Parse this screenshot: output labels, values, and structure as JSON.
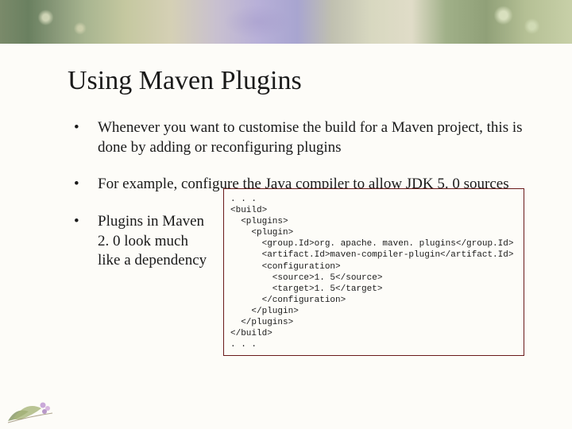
{
  "title": "Using Maven Plugins",
  "bullets": [
    "Whenever you want to customise the build for a Maven project, this is done by adding or reconfiguring plugins",
    "For example, configure the Java compiler to allow JDK 5. 0 sources",
    "Plugins in Maven 2. 0 look much like a dependency"
  ],
  "code": ". . .\n<build>\n  <plugins>\n    <plugin>\n      <group.Id>org. apache. maven. plugins</group.Id>\n      <artifact.Id>maven-compiler-plugin</artifact.Id>\n      <configuration>\n        <source>1. 5</source>\n        <target>1. 5</target>\n      </configuration>\n    </plugin>\n  </plugins>\n</build>\n. . ."
}
